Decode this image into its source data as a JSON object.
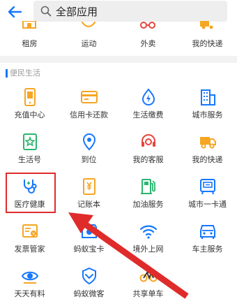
{
  "header": {
    "search_text": "全部应用",
    "back_icon": "back-arrow-icon",
    "search_icon": "search-icon"
  },
  "top_row": [
    {
      "label": "租房",
      "icon": "house-icon"
    },
    {
      "label": "运动",
      "icon": "sport-icon"
    },
    {
      "label": "外卖",
      "icon": "takeout-icon"
    },
    {
      "label": "我的快递",
      "icon": "delivery-icon"
    }
  ],
  "section": {
    "title": "便民生活"
  },
  "grid": [
    [
      {
        "label": "充值中心",
        "icon": "phone-icon"
      },
      {
        "label": "信用卡还款",
        "icon": "credit-card-icon"
      },
      {
        "label": "生活缴费",
        "icon": "bolt-icon"
      },
      {
        "label": "城市服务",
        "icon": "building-icon"
      }
    ],
    [
      {
        "label": "生活号",
        "icon": "star-badge-icon"
      },
      {
        "label": "到位",
        "icon": "location-pin-icon"
      },
      {
        "label": "我的客服",
        "icon": "customer-service-icon"
      },
      {
        "label": "我的快递",
        "icon": "truck-icon"
      }
    ],
    [
      {
        "label": "医疗健康",
        "icon": "stethoscope-icon"
      },
      {
        "label": "记账本",
        "icon": "ledger-icon"
      },
      {
        "label": "加油服务",
        "icon": "gas-station-icon"
      },
      {
        "label": "城市一卡通",
        "icon": "transit-card-icon"
      }
    ],
    [
      {
        "label": "发票管家",
        "icon": "invoice-icon"
      },
      {
        "label": "蚂蚁宝卡",
        "icon": "ant-card-icon"
      },
      {
        "label": "境外上网",
        "icon": "wifi-icon"
      },
      {
        "label": "车主服务",
        "icon": "car-icon"
      }
    ],
    [
      {
        "label": "天天有料",
        "icon": "eye-icon"
      },
      {
        "label": "蚂蚁微客",
        "icon": "heart-shield-icon"
      },
      {
        "label": "共享单车",
        "icon": "bicycle-icon"
      }
    ]
  ],
  "colors": {
    "icon_blue": "#1677ff",
    "icon_orange": "#f5a623",
    "icon_red": "#e6453c",
    "highlight_red": "#e02b2b"
  }
}
